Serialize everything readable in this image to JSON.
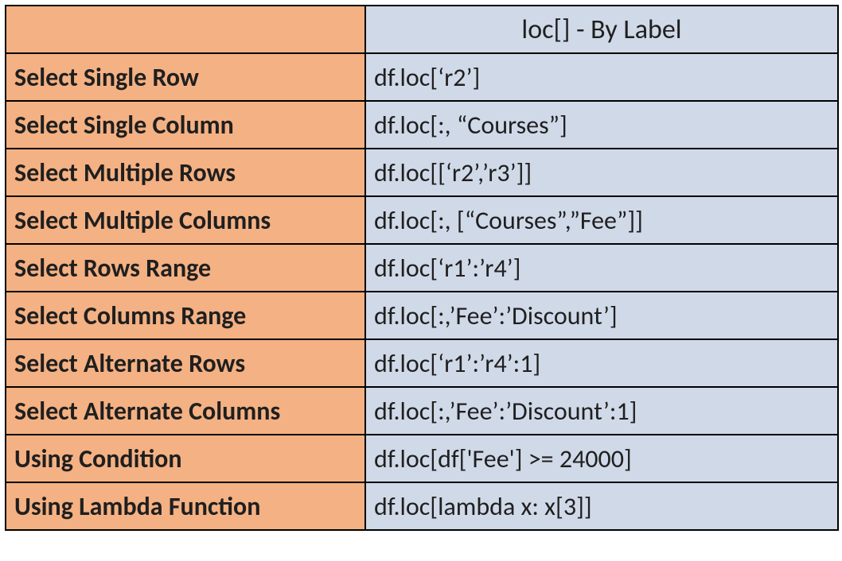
{
  "header": {
    "left": "",
    "right": "loc[] - By Label"
  },
  "rows": [
    {
      "label": "Select Single Row",
      "code": "df.loc[‘r2’]"
    },
    {
      "label": "Select Single Column",
      "code": "df.loc[:, “Courses”]"
    },
    {
      "label": "Select Multiple Rows",
      "code": "df.loc[[‘r2’,’r3’]]"
    },
    {
      "label": "Select Multiple Columns",
      "code": "df.loc[:, [“Courses”,”Fee”]]"
    },
    {
      "label": "Select Rows Range",
      "code": "df.loc[‘r1’:’r4’]"
    },
    {
      "label": "Select Columns Range",
      "code": "df.loc[:,’Fee’:’Discount’]"
    },
    {
      "label": "Select Alternate Rows",
      "code": "df.loc[‘r1’:’r4’:1]"
    },
    {
      "label": "Select Alternate Columns",
      "code": "df.loc[:,’Fee’:’Discount’:1]"
    },
    {
      "label": "Using Condition",
      "code": "df.loc[df['Fee'] >= 24000]"
    },
    {
      "label": "Using Lambda Function",
      "code": "df.loc[lambda x: x[3]]"
    }
  ]
}
